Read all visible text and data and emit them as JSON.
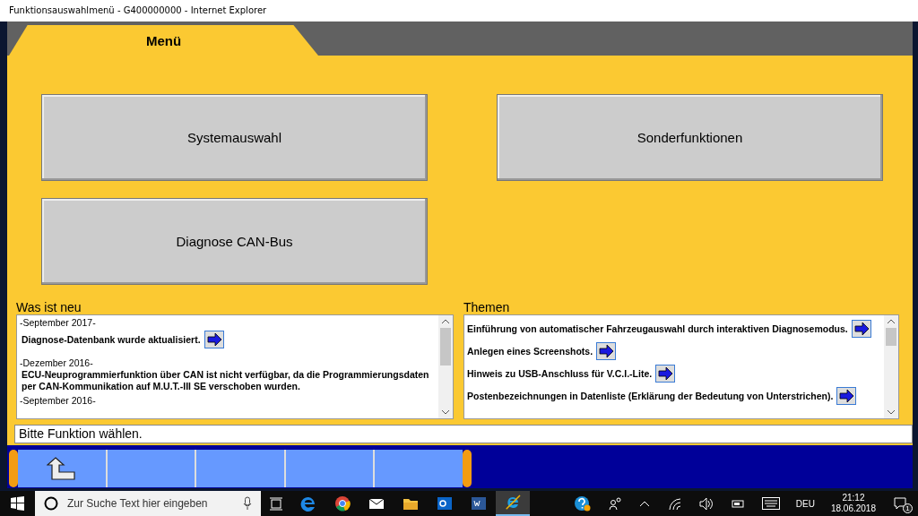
{
  "window": {
    "title": "Funktionsauswahlmenü - G400000000 - Internet Explorer"
  },
  "tab": {
    "label": "Menü",
    "selected": true
  },
  "menu_buttons": [
    {
      "label": "Systemauswahl"
    },
    {
      "label": "Sonderfunktionen"
    },
    {
      "label": "Diagnose CAN-Bus"
    }
  ],
  "news": {
    "title": "Was ist neu",
    "entries": [
      {
        "kind": "heading",
        "text": "-September 2017-"
      },
      {
        "kind": "link",
        "text": "Diagnose-Datenbank wurde aktualisiert."
      },
      {
        "kind": "heading",
        "text": "-Dezember 2016-"
      },
      {
        "kind": "text",
        "text": "ECU-Neuprogrammierfunktion über CAN ist nicht verfügbar, da die Programmierungsdaten per CAN-Kommunikation auf M.U.T.-III SE verschoben wurden."
      },
      {
        "kind": "heading",
        "text": "-September 2016-"
      }
    ]
  },
  "topics": {
    "title": "Themen",
    "items": [
      {
        "text": "Einführung von automatischer Fahrzeugauswahl durch interaktiven Diagnosemodus."
      },
      {
        "text": "Anlegen eines Screenshots."
      },
      {
        "text": "Hinweis zu USB-Anschluss für V.C.I.-Lite."
      },
      {
        "text": "Postenbezeichnungen in Datenliste (Erklärung der Bedeutung von Unterstrichen)."
      }
    ]
  },
  "status_bar": {
    "text": "Bitte Funktion wählen."
  },
  "function_keys": [
    {
      "kind": "back"
    },
    {
      "kind": "empty"
    },
    {
      "kind": "empty"
    },
    {
      "kind": "empty"
    },
    {
      "kind": "empty"
    }
  ],
  "taskbar": {
    "search": {
      "placeholder": "Zur Suche Text hier eingeben"
    },
    "apps": [
      {
        "kind": "edge",
        "selected": false
      },
      {
        "kind": "chrome",
        "selected": false
      },
      {
        "kind": "mail",
        "selected": false
      },
      {
        "kind": "folder",
        "selected": false
      },
      {
        "kind": "outlook",
        "selected": false
      },
      {
        "kind": "word",
        "selected": false
      },
      {
        "kind": "ie",
        "selected": true
      }
    ],
    "language": "DEU",
    "time": "21:12",
    "date": "18.06.2018",
    "notifications": "1"
  }
}
